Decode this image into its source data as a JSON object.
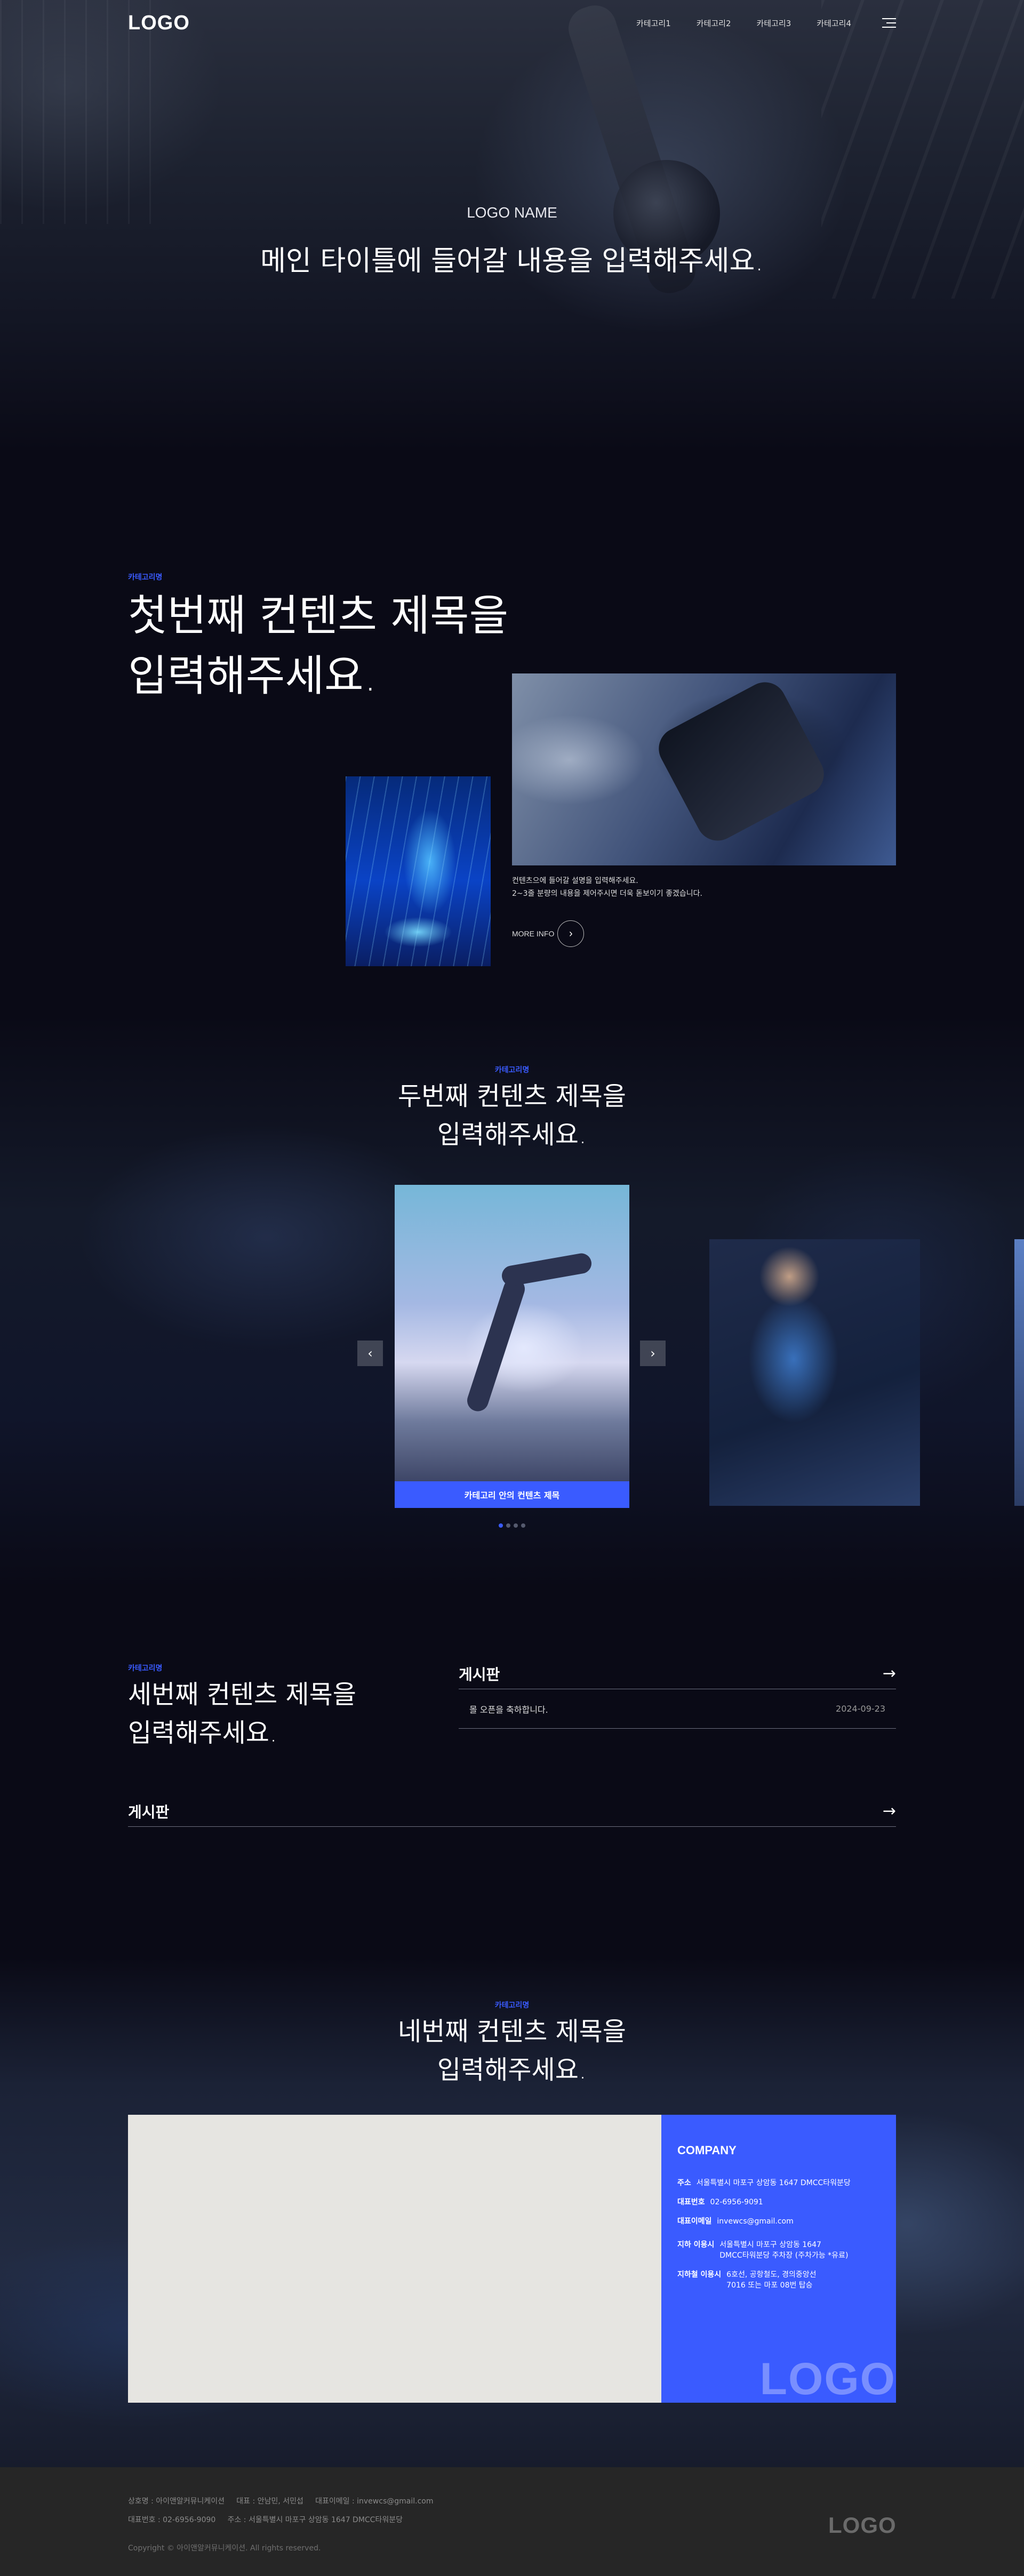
{
  "header": {
    "logo": "LOGO",
    "nav": [
      "카테고리1",
      "카테고리2",
      "카테고리3",
      "카테고리4"
    ]
  },
  "hero": {
    "subtitle": "LOGO NAME",
    "title": "메인 타이틀에 들어갈 내용을 입력해주세요."
  },
  "section1": {
    "category": "카테고리명",
    "title_line1": "첫번째 컨텐츠 제목을",
    "title_line2": "입력해주세요.",
    "desc_line1": "컨텐츠으에 들어갈 설명을 입력해주세요.",
    "desc_line2": "2~3줄 분량의 내용을 제어주시면 더욱 돋보이기 좋겠습니다.",
    "more_label": "MORE INFO"
  },
  "section2": {
    "category": "카테고리명",
    "title_line1": "두번째 컨텐츠 제목을",
    "title_line2": "입력해주세요.",
    "card_caption": "카테고리 안의 컨텐츠 제목",
    "dots_count": 4,
    "active_dot": 0
  },
  "section3": {
    "category": "카테고리명",
    "title_line1": "세번째 컨텐츠 제목을",
    "title_line2": "입력해주세요.",
    "board1": {
      "title": "게시판",
      "rows": [
        {
          "text": "몰 오픈을 축하합니다.",
          "date": "2024-09-23"
        }
      ]
    },
    "board2": {
      "title": "게시판"
    }
  },
  "section4": {
    "category": "카테고리명",
    "title_line1": "네번째 컨텐츠 제목을",
    "title_line2": "입력해주세요.",
    "company": {
      "heading": "COMPANY",
      "rows": [
        {
          "k": "주소",
          "v": "서울특별시 마포구 상암동 1647 DMCC타워분당"
        },
        {
          "k": "대표번호",
          "v": "02-6956-9091"
        },
        {
          "k": "대표이메일",
          "v": "invewcs@gmail.com"
        },
        {
          "k": "지하 이용시",
          "v": "서울특별시 마포구 상암동 1647\nDMCC타워분당 주차장 (주차가능 *유료)"
        },
        {
          "k": "지하철 이용시",
          "v": "6호선, 공항철도, 경의중앙선\n7016 또는 마포 08번 탑승"
        }
      ],
      "watermark": "LOGO"
    }
  },
  "footer": {
    "line1": "상호명 : 아이앤알커뮤니케이션     대표 : 안남민, 서민섭     대표이메일 : invewcs@gmail.com",
    "line2": "대표번호 : 02-6956-9090     주소 : 서울특별시 마포구 상암동 1647 DMCC타워분당",
    "copyright": "Copyright © 아이앤알커뮤니케이션. All rights reserved.",
    "logo": "LOGO"
  },
  "colors": {
    "accent": "#3a5bff",
    "background": "#0a0a16",
    "footer": "#262626"
  }
}
